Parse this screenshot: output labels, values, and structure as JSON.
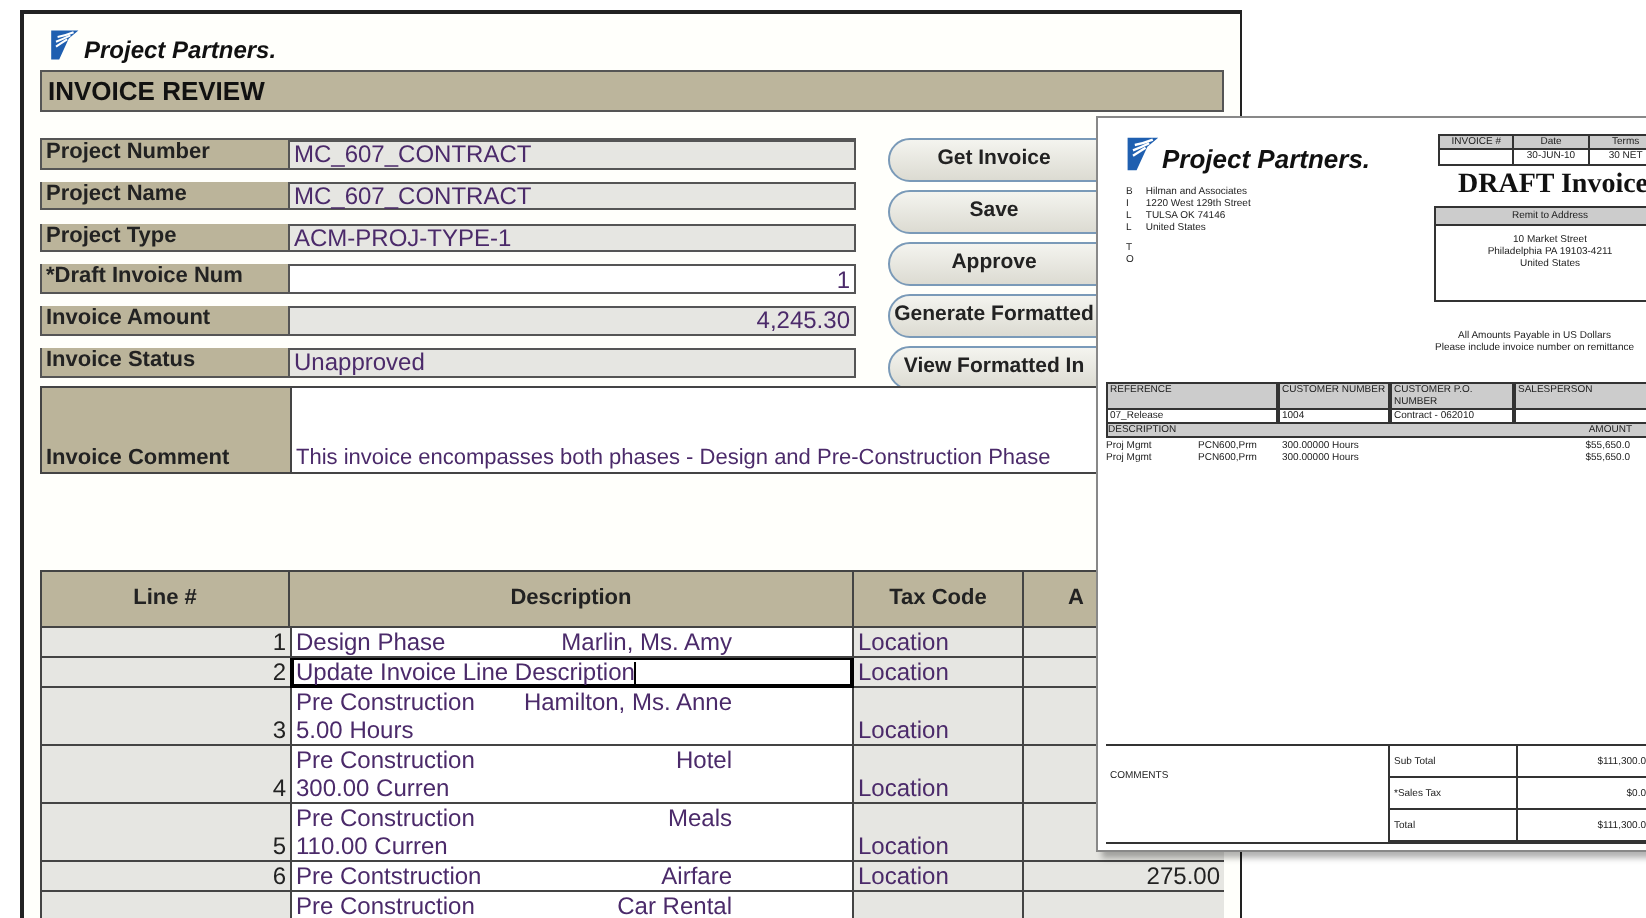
{
  "logo": {
    "name": "Project Partners."
  },
  "title": "INVOICE REVIEW",
  "fields": [
    {
      "label": "Project Number",
      "value": "MC_607_CONTRACT",
      "kind": "text"
    },
    {
      "label": "Project Name",
      "value": "MC_607_CONTRACT",
      "kind": "text"
    },
    {
      "label": "Project Type",
      "value": "ACM-PROJ-TYPE-1",
      "kind": "text"
    },
    {
      "label": "*Draft Invoice Num",
      "value": "1",
      "kind": "input"
    },
    {
      "label": "Invoice Amount",
      "value": "4,245.30",
      "kind": "number"
    },
    {
      "label": "Invoice Status",
      "value": "Unapproved",
      "kind": "text"
    }
  ],
  "buttons": [
    "Get Invoice",
    "Save",
    "Approve",
    "Generate Formatted",
    "View Formatted In"
  ],
  "comment": {
    "label": "Invoice Comment",
    "value": "This invoice encompasses both phases - Design and Pre-Construction Phase"
  },
  "lines": {
    "columns": [
      "Line #",
      "Description",
      "Tax Code",
      "A"
    ],
    "rows": [
      {
        "line": "1",
        "description": [
          [
            "Design Phase",
            "Marlin, Ms. Amy"
          ]
        ],
        "tax_code": "Location",
        "focused": false
      },
      {
        "line": "2",
        "description": [
          [
            "Update Invoice Line Description"
          ]
        ],
        "tax_code": "Location",
        "focused": true
      },
      {
        "line": "3",
        "description": [
          [
            "Pre Construction",
            "Hamilton, Ms. Anne"
          ],
          [
            "5.00 Hours"
          ]
        ],
        "tax_code": "Location",
        "focused": false
      },
      {
        "line": "4",
        "description": [
          [
            "Pre Construction",
            "Hotel"
          ],
          [
            "300.00  Curren"
          ]
        ],
        "tax_code": "Location",
        "focused": false
      },
      {
        "line": "5",
        "description": [
          [
            "Pre Construction",
            "Meals"
          ],
          [
            "110.00  Curren"
          ]
        ],
        "tax_code": "Location",
        "focused": false
      },
      {
        "line": "6",
        "description": [
          [
            "Pre Contstruction",
            "Airfare"
          ]
        ],
        "tax_code": "Location",
        "amount": "275.00",
        "focused": false
      },
      {
        "description": [
          [
            "Pre Construction",
            "Car Rental"
          ]
        ],
        "focused": false
      }
    ]
  },
  "document": {
    "logo": "Project Partners.",
    "meta": [
      {
        "label": "INVOICE #"
      },
      {
        "label": "Date",
        "value": "30-JUN-10"
      },
      {
        "label": "Terms",
        "value": "30 NET"
      }
    ],
    "heading": "DRAFT Invoice",
    "bill_to": {
      "label_lines": [
        "BILL",
        "TO"
      ],
      "lines": [
        "Hilman and Associates",
        "1220 West 129th Street",
        "TULSA OK 74146",
        "United States"
      ]
    },
    "remit": {
      "label": "Remit to Address",
      "lines": [
        "10 Market Street",
        "Philadelphia PA 19103-4211",
        "United States"
      ]
    },
    "notice": [
      "All Amounts Payable in US Dollars",
      "Please include invoice number on remittance"
    ],
    "reference": {
      "columns": [
        "REFERENCE",
        "CUSTOMER NUMBER",
        "CUSTOMER P.O. NUMBER",
        "SALESPERSON"
      ],
      "values": [
        "07_Release",
        "1004",
        "Contract - 062010"
      ]
    },
    "items": {
      "columns": [
        "DESCRIPTION",
        "AMOUNT"
      ],
      "rows": [
        {
          "cells": [
            "Proj Mgmt",
            "PCN600,Prm",
            "300.00000 Hours"
          ],
          "amount": "$55,650.0"
        },
        {
          "cells": [
            "Proj Mgmt",
            "PCN600,Prm",
            "300.00000 Hours"
          ],
          "amount": "$55,650.0"
        }
      ]
    },
    "comments_label": "COMMENTS",
    "totals": [
      {
        "label": "Sub Total",
        "value": "$111,300.0"
      },
      {
        "label": "*Sales Tax",
        "value": "$0.0"
      },
      {
        "label": "Total",
        "value": "$111,300.0"
      }
    ]
  }
}
